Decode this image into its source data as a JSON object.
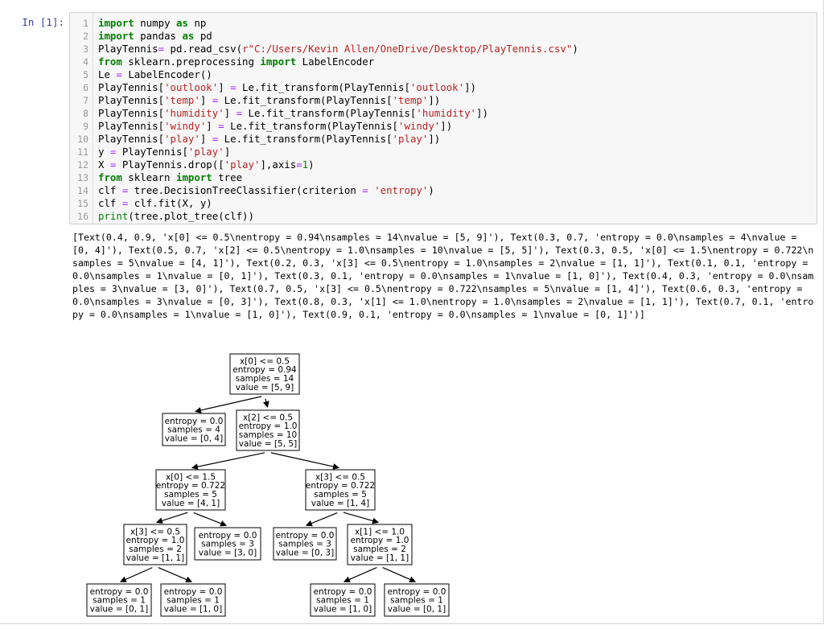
{
  "cell": {
    "prompt": "In [1]:",
    "code_lines": [
      {
        "n": "1",
        "html": "<span class=\"kw\">import</span> numpy <span class=\"kw\">as</span> np"
      },
      {
        "n": "2",
        "html": "<span class=\"kw\">import</span> pandas <span class=\"kw\">as</span> pd"
      },
      {
        "n": "3",
        "html": "PlayTennis<span class=\"op\">=</span> pd.read_csv(<span class=\"st\">r\"C:/Users/Kevin Allen/OneDrive/Desktop/PlayTennis.csv\"</span>)"
      },
      {
        "n": "4",
        "html": "<span class=\"kw\">from</span> sklearn.preprocessing <span class=\"kw\">import</span> LabelEncoder"
      },
      {
        "n": "5",
        "html": "Le <span class=\"op\">=</span> LabelEncoder()"
      },
      {
        "n": "6",
        "html": "PlayTennis[<span class=\"st\">'outlook'</span>] <span class=\"op\">=</span> Le.fit_transform(PlayTennis[<span class=\"st\">'outlook'</span>])"
      },
      {
        "n": "7",
        "html": "PlayTennis[<span class=\"st\">'temp'</span>] <span class=\"op\">=</span> Le.fit_transform(PlayTennis[<span class=\"st\">'temp'</span>])"
      },
      {
        "n": "8",
        "html": "PlayTennis[<span class=\"st\">'humidity'</span>] <span class=\"op\">=</span> Le.fit_transform(PlayTennis[<span class=\"st\">'humidity'</span>])"
      },
      {
        "n": "9",
        "html": "PlayTennis[<span class=\"st\">'windy'</span>] <span class=\"op\">=</span> Le.fit_transform(PlayTennis[<span class=\"st\">'windy'</span>])"
      },
      {
        "n": "10",
        "html": "PlayTennis[<span class=\"st\">'play'</span>] <span class=\"op\">=</span> Le.fit_transform(PlayTennis[<span class=\"st\">'play'</span>])"
      },
      {
        "n": "11",
        "html": "y <span class=\"op\">=</span> PlayTennis[<span class=\"st\">'play'</span>]"
      },
      {
        "n": "12",
        "html": "X <span class=\"op\">=</span> PlayTennis.drop([<span class=\"st\">'play'</span>],axis<span class=\"op\">=</span><span class=\"nm\">1</span>)"
      },
      {
        "n": "13",
        "html": "<span class=\"kw\">from</span> sklearn <span class=\"kw\">import</span> tree"
      },
      {
        "n": "14",
        "html": "clf <span class=\"op\">=</span> tree.DecisionTreeClassifier(criterion <span class=\"op\">=</span> <span class=\"st\">'entropy'</span>)"
      },
      {
        "n": "15",
        "html": "clf <span class=\"op\">=</span> clf.fit(X, y)"
      },
      {
        "n": "16",
        "html": "<span class=\"bi\">print</span>(tree.plot_tree(clf))"
      }
    ],
    "output": "[Text(0.4, 0.9, 'x[0] <= 0.5\\nentropy = 0.94\\nsamples = 14\\nvalue = [5, 9]'), Text(0.3, 0.7, 'entropy = 0.0\\nsamples = 4\\nvalue = [0, 4]'), Text(0.5, 0.7, 'x[2] <= 0.5\\nentropy = 1.0\\nsamples = 10\\nvalue = [5, 5]'), Text(0.3, 0.5, 'x[0] <= 1.5\\nentropy = 0.722\\nsamples = 5\\nvalue = [4, 1]'), Text(0.2, 0.3, 'x[3] <= 0.5\\nentropy = 1.0\\nsamples = 2\\nvalue = [1, 1]'), Text(0.1, 0.1, 'entropy = 0.0\\nsamples = 1\\nvalue = [0, 1]'), Text(0.3, 0.1, 'entropy = 0.0\\nsamples = 1\\nvalue = [1, 0]'), Text(0.4, 0.3, 'entropy = 0.0\\nsamples = 3\\nvalue = [3, 0]'), Text(0.7, 0.5, 'x[3] <= 0.5\\nentropy = 0.722\\nsamples = 5\\nvalue = [1, 4]'), Text(0.6, 0.3, 'entropy = 0.0\\nsamples = 3\\nvalue = [0, 3]'), Text(0.8, 0.3, 'x[1] <= 1.0\\nentropy = 1.0\\nsamples = 2\\nvalue = [1, 1]'), Text(0.7, 0.1, 'entropy = 0.0\\nsamples = 1\\nvalue = [1, 0]'), Text(0.9, 0.1, 'entropy = 0.0\\nsamples = 1\\nvalue = [0, 1]')]"
  },
  "tree": {
    "nodes": [
      {
        "id": "n0",
        "lines": [
          "x[0] <= 0.5",
          "entropy = 0.94",
          "samples = 14",
          "value = [5, 9]"
        ]
      },
      {
        "id": "n1",
        "lines": [
          "entropy = 0.0",
          "samples = 4",
          "value = [0, 4]"
        ]
      },
      {
        "id": "n2",
        "lines": [
          "x[2] <= 0.5",
          "entropy = 1.0",
          "samples = 10",
          "value = [5, 5]"
        ]
      },
      {
        "id": "n3",
        "lines": [
          "x[0] <= 1.5",
          "entropy = 0.722",
          "samples = 5",
          "value = [4, 1]"
        ]
      },
      {
        "id": "n4",
        "lines": [
          "x[3] <= 0.5",
          "entropy = 0.722",
          "samples = 5",
          "value = [1, 4]"
        ]
      },
      {
        "id": "n5",
        "lines": [
          "x[3] <= 0.5",
          "entropy = 1.0",
          "samples = 2",
          "value = [1, 1]"
        ]
      },
      {
        "id": "n6",
        "lines": [
          "entropy = 0.0",
          "samples = 3",
          "value = [3, 0]"
        ]
      },
      {
        "id": "n7",
        "lines": [
          "entropy = 0.0",
          "samples = 3",
          "value = [0, 3]"
        ]
      },
      {
        "id": "n8",
        "lines": [
          "x[1] <= 1.0",
          "entropy = 1.0",
          "samples = 2",
          "value = [1, 1]"
        ]
      },
      {
        "id": "n9",
        "lines": [
          "entropy = 0.0",
          "samples = 1",
          "value = [0, 1]"
        ]
      },
      {
        "id": "n10",
        "lines": [
          "entropy = 0.0",
          "samples = 1",
          "value = [1, 0]"
        ]
      },
      {
        "id": "n11",
        "lines": [
          "entropy = 0.0",
          "samples = 1",
          "value = [1, 0]"
        ]
      },
      {
        "id": "n12",
        "lines": [
          "entropy = 0.0",
          "samples = 1",
          "value = [0, 1]"
        ]
      }
    ],
    "edges": [
      [
        "n0",
        "n1"
      ],
      [
        "n0",
        "n2"
      ],
      [
        "n2",
        "n3"
      ],
      [
        "n2",
        "n4"
      ],
      [
        "n3",
        "n5"
      ],
      [
        "n3",
        "n6"
      ],
      [
        "n4",
        "n7"
      ],
      [
        "n4",
        "n8"
      ],
      [
        "n5",
        "n9"
      ],
      [
        "n5",
        "n10"
      ],
      [
        "n8",
        "n11"
      ],
      [
        "n8",
        "n12"
      ]
    ]
  }
}
